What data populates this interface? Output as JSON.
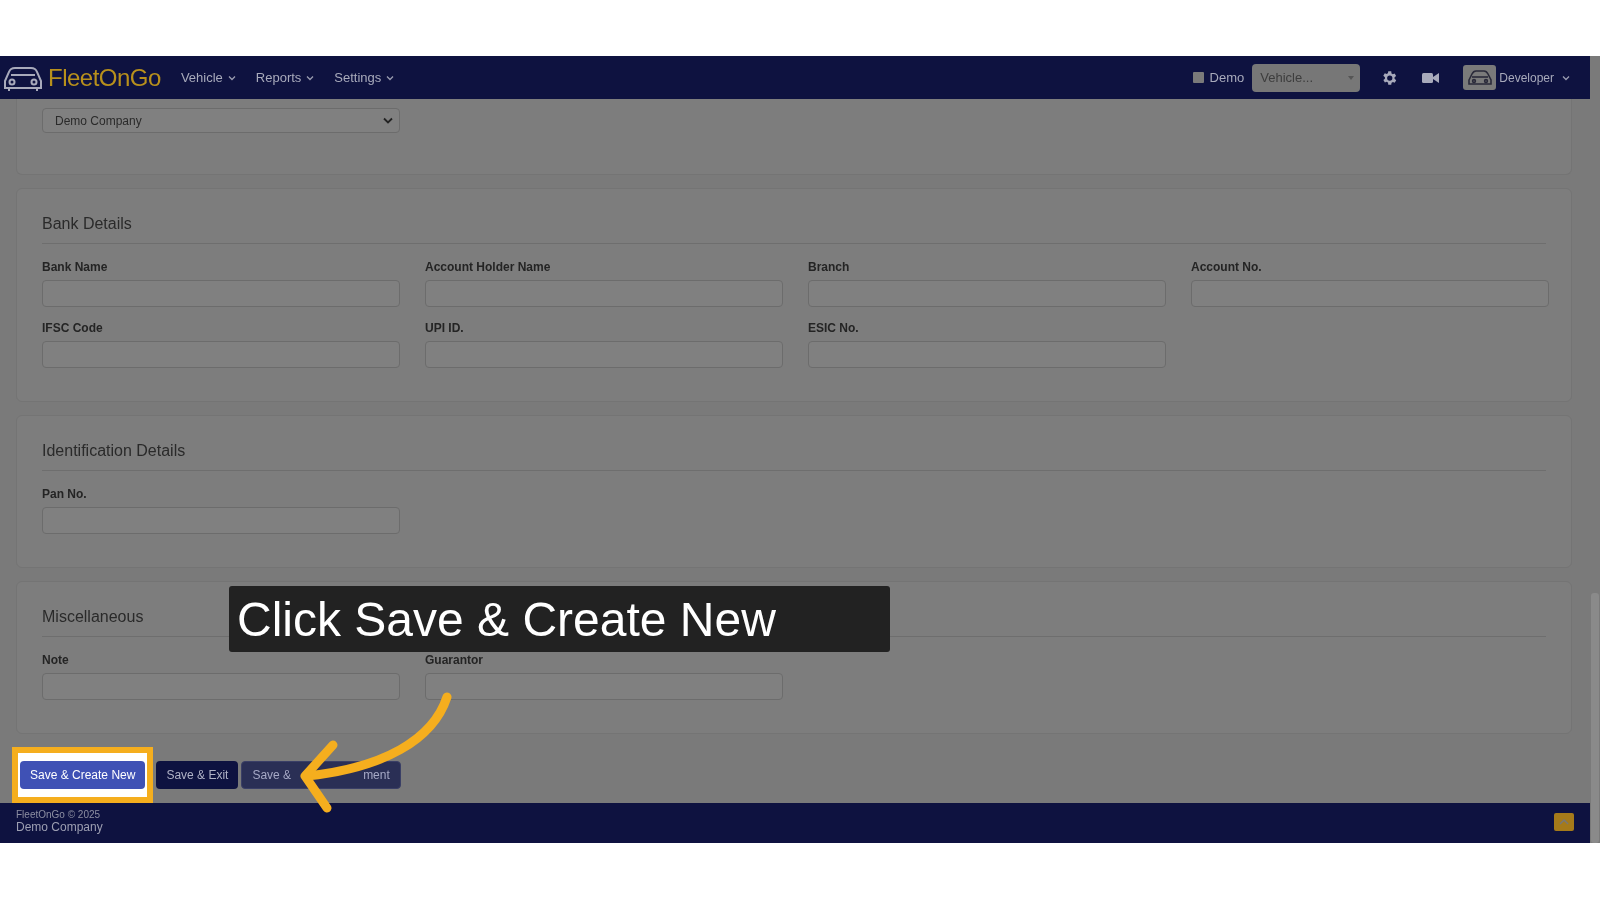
{
  "navbar": {
    "brand": "FleetOnGo",
    "menus": [
      {
        "label": "Vehicle"
      },
      {
        "label": "Reports"
      },
      {
        "label": "Settings"
      }
    ],
    "demo": {
      "label": "Demo",
      "checked": false
    },
    "vehicle_select": {
      "value": "Vehicle..."
    },
    "user": {
      "name": "Developer"
    }
  },
  "company_select": {
    "value": "Demo Company"
  },
  "sections": [
    {
      "title": "Bank Details",
      "fields": [
        {
          "label": "Bank Name"
        },
        {
          "label": "Account Holder Name"
        },
        {
          "label": "Branch"
        },
        {
          "label": "Account No."
        },
        {
          "label": "IFSC Code"
        },
        {
          "label": "UPI ID."
        },
        {
          "label": "ESIC No."
        }
      ]
    },
    {
      "title": "Identification Details",
      "fields": [
        {
          "label": "Pan No."
        }
      ]
    },
    {
      "title": "Miscellaneous",
      "fields": [
        {
          "label": "Note"
        },
        {
          "label": "Guarantor"
        }
      ]
    }
  ],
  "buttons": [
    {
      "kind": "primary",
      "parts": [
        "Save & Create New"
      ]
    },
    {
      "kind": "dark",
      "parts": [
        "Save & Exit"
      ]
    },
    {
      "kind": "muted",
      "parts": [
        "Save &",
        "ment"
      ]
    }
  ],
  "footer": {
    "brand": "FleetOnGo",
    "copyright": "© 2025",
    "company": "Demo Company"
  },
  "tutorial": {
    "caption": "Click Save & Create New"
  }
}
